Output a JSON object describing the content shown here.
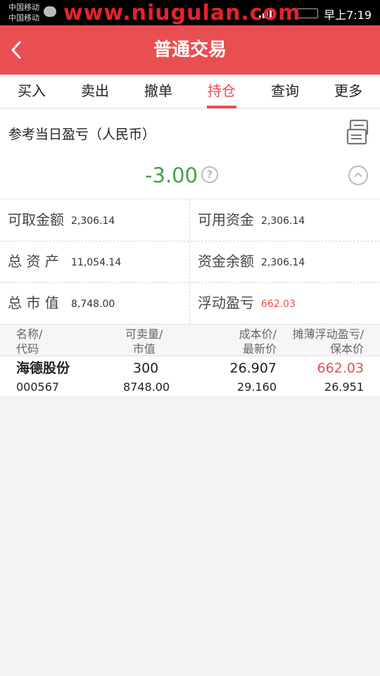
{
  "status_bar": {
    "carrier1": "中国移动",
    "carrier2": "中国移动",
    "watermark": "www.niugulan.com",
    "time": "早上7:19"
  },
  "header": {
    "title": "普通交易"
  },
  "tabs": [
    {
      "label": "买入"
    },
    {
      "label": "卖出"
    },
    {
      "label": "撤单"
    },
    {
      "label": "持仓",
      "active": true
    },
    {
      "label": "查询"
    },
    {
      "label": "更多"
    }
  ],
  "profit": {
    "label": "参考当日盈亏（人民币）",
    "value": "-3.00",
    "help": "?"
  },
  "summary": [
    {
      "label": "可取金额",
      "value": "2,306.14"
    },
    {
      "label": "可用资金",
      "value": "2,306.14"
    },
    {
      "label": "总 资 产",
      "value": "11,054.14"
    },
    {
      "label": "资金余额",
      "value": "2,306.14"
    },
    {
      "label": "总 市 值",
      "value": "8,748.00"
    },
    {
      "label": "浮动盈亏",
      "value": "662.03"
    }
  ],
  "table": {
    "headers": {
      "name": "名称/",
      "code": "代码",
      "sellable": "可卖量/",
      "market_value": "市值",
      "cost": "成本价/",
      "latest": "最新价",
      "float_profit": "摊薄浮动盈亏/",
      "breakeven": "保本价"
    },
    "rows": [
      {
        "name": "海德股份",
        "code": "000567",
        "sellable": "300",
        "market_value": "8748.00",
        "cost": "26.907",
        "latest": "29.160",
        "float_profit": "662.03",
        "breakeven": "26.951"
      }
    ]
  },
  "colors": {
    "brand_red": "#e94e51",
    "profit_negative_green": "#3ea447",
    "profit_positive_red": "#e94e51"
  }
}
